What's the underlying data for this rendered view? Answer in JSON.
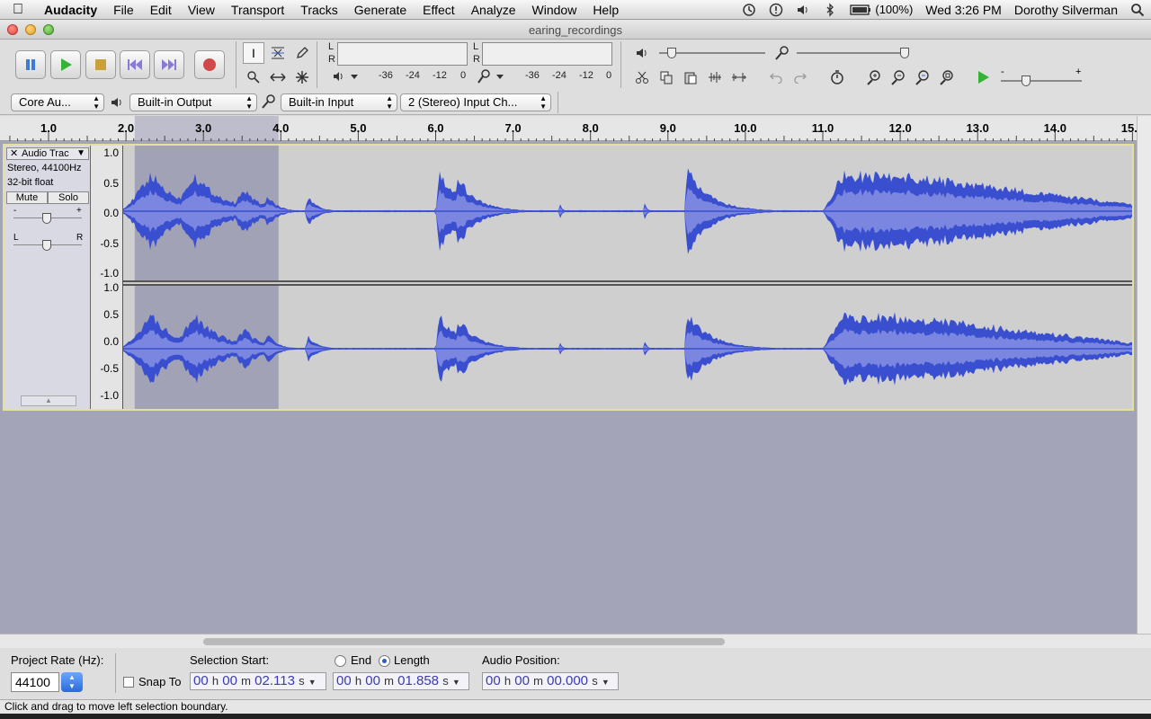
{
  "menubar": {
    "app": "Audacity",
    "items": [
      "File",
      "Edit",
      "View",
      "Transport",
      "Tracks",
      "Generate",
      "Effect",
      "Analyze",
      "Window",
      "Help"
    ],
    "battery": "(100%)",
    "clock": "Wed 3:26 PM",
    "user": "Dorothy Silverman"
  },
  "window": {
    "title": "earing_recordings"
  },
  "meters": {
    "play_scale": [
      "-36",
      "-24",
      "-12",
      "0"
    ],
    "rec_scale": [
      "-36",
      "-24",
      "-12",
      "0"
    ],
    "left": "L",
    "right": "R"
  },
  "devices": {
    "host": "Core Au...",
    "output": "Built-in Output",
    "input": "Built-in Input",
    "channels": "2 (Stereo) Input Ch..."
  },
  "ruler": {
    "labels": [
      "1.0",
      "2.0",
      "3.0",
      "4.0",
      "5.0",
      "6.0",
      "7.0",
      "8.0",
      "9.0",
      "10.0",
      "11.0",
      "12.0",
      "13.0",
      "14.0",
      "15.0"
    ]
  },
  "track": {
    "name": "Audio Trac",
    "format": "Stereo, 44100Hz",
    "bitdepth": "32-bit float",
    "mute": "Mute",
    "solo": "Solo",
    "gain_minus": "-",
    "gain_plus": "+",
    "pan_left": "L",
    "pan_right": "R",
    "vscale": [
      "1.0",
      "0.5",
      "0.0",
      "-0.5",
      "-1.0"
    ],
    "selection_start_s": 2.113,
    "selection_length_s": 1.858
  },
  "selbar": {
    "rate_label": "Project Rate (Hz):",
    "rate": "44100",
    "snap": "Snap To",
    "sel_start_label": "Selection Start:",
    "end_label": "End",
    "length_label": "Length",
    "audio_pos_label": "Audio Position:",
    "sel_start": {
      "h": "00",
      "m": "00",
      "s": "02.113"
    },
    "length": {
      "h": "00",
      "m": "00",
      "s": "01.858"
    },
    "audio_pos": {
      "h": "00",
      "m": "00",
      "s": "00.000"
    },
    "unit_h": "h",
    "unit_m": "m",
    "unit_s": "s"
  },
  "status": "Click and drag to move left selection boundary.",
  "colors": {
    "waveform": "#3a4fd0",
    "waveform_rms": "#7b86e0",
    "selection": "#a2a2b6",
    "track_bg": "#cfcfcf"
  }
}
